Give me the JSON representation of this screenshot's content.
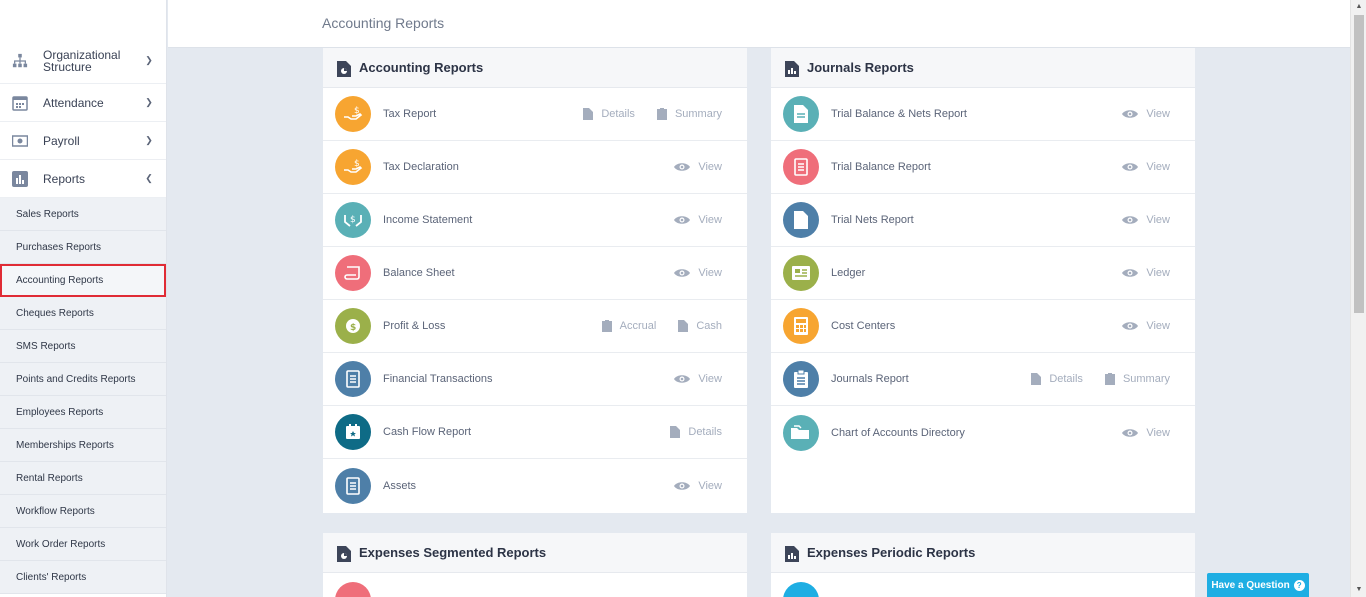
{
  "page": {
    "title": "Accounting Reports"
  },
  "sidebar": {
    "nav": [
      {
        "label": "Organizational Structure",
        "icon": "org-chart-icon"
      },
      {
        "label": "Attendance",
        "icon": "calendar-icon"
      },
      {
        "label": "Payroll",
        "icon": "money-icon"
      },
      {
        "label": "Reports",
        "icon": "bar-chart-icon"
      }
    ],
    "sub": [
      "Sales Reports",
      "Purchases Reports",
      "Accounting Reports",
      "Cheques Reports",
      "SMS Reports",
      "Points and Credits Reports",
      "Employees Reports",
      "Memberships Reports",
      "Rental Reports",
      "Workflow Reports",
      "Work Order Reports",
      "Clients' Reports"
    ]
  },
  "panels": {
    "accounting": {
      "title": "Accounting Reports",
      "rows": [
        {
          "label": "Tax Report",
          "color": "#f7a531",
          "a1": "Details",
          "a2": "Summary"
        },
        {
          "label": "Tax Declaration",
          "color": "#f7a531",
          "a1": "View"
        },
        {
          "label": "Income Statement",
          "color": "#5ab0b6",
          "a1": "View"
        },
        {
          "label": "Balance Sheet",
          "color": "#ef6e7a",
          "a1": "View"
        },
        {
          "label": "Profit & Loss",
          "color": "#9bb04a",
          "a1": "Accrual",
          "a2": "Cash"
        },
        {
          "label": "Financial Transactions",
          "color": "#4e7fa8",
          "a1": "View"
        },
        {
          "label": "Cash Flow Report",
          "color": "#0e6b86",
          "a1": "Details"
        },
        {
          "label": "Assets",
          "color": "#4e7fa8",
          "a1": "View"
        }
      ]
    },
    "journals": {
      "title": "Journals Reports",
      "rows": [
        {
          "label": "Trial Balance & Nets Report",
          "color": "#5ab0b6",
          "a1": "View"
        },
        {
          "label": "Trial Balance Report",
          "color": "#ef6e7a",
          "a1": "View"
        },
        {
          "label": "Trial Nets Report",
          "color": "#4e7fa8",
          "a1": "View"
        },
        {
          "label": "Ledger",
          "color": "#9bb04a",
          "a1": "View"
        },
        {
          "label": "Cost Centers",
          "color": "#f7a531",
          "a1": "View"
        },
        {
          "label": "Journals Report",
          "color": "#4e7fa8",
          "a1": "Details",
          "a2": "Summary"
        },
        {
          "label": "Chart of Accounts Directory",
          "color": "#5ab0b6",
          "a1": "View"
        }
      ]
    },
    "expenses_segmented": {
      "title": "Expenses Segmented Reports"
    },
    "expenses_periodic": {
      "title": "Expenses Periodic Reports"
    }
  },
  "help": {
    "label": "Have a Question",
    "q": "?"
  }
}
